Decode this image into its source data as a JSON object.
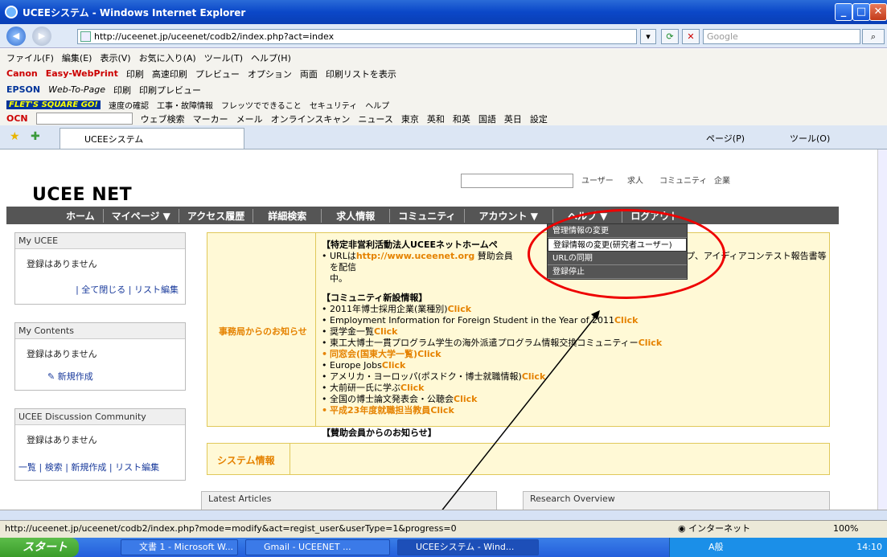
{
  "window": {
    "title": "UCEEシステム - Windows Internet Explorer",
    "min": "_",
    "max": "□",
    "close": "✕"
  },
  "address": {
    "url": "http://uceenet.jp/uceenet/codb2/index.php?act=index",
    "search_placeholder": "Google"
  },
  "menu": [
    "ファイル(F)",
    "編集(E)",
    "表示(V)",
    "お気に入り(A)",
    "ツール(T)",
    "ヘルプ(H)"
  ],
  "toolbar_canon": {
    "brand": "Canon",
    "product": "Easy-WebPrint",
    "items": [
      "印刷",
      "高速印刷",
      "プレビュー",
      "オプション",
      "両面",
      "印刷リストを表示"
    ]
  },
  "toolbar_epson": {
    "brand": "EPSON",
    "product": "Web-To-Page",
    "items": [
      "印刷",
      "印刷プレビュー"
    ]
  },
  "toolbar_flets": {
    "brand": "FLET'S SQUARE GO!",
    "items": [
      "速度の確認",
      "工事・故障情報",
      "フレッツでできること",
      "セキュリティ",
      "ヘルプ"
    ]
  },
  "toolbar_ocn": {
    "brand": "OCN",
    "items": [
      "ウェブ検索",
      "マーカー",
      "メール",
      "オンラインスキャン",
      "ニュース",
      "東京",
      "英和",
      "和英",
      "国語",
      "英日",
      "設定"
    ]
  },
  "tab": {
    "label": "UCEEシステム"
  },
  "tab_tools": [
    "ページ(P)",
    "ツール(O)"
  ],
  "site": {
    "logo": "UCEE NET",
    "search_tabs": [
      "ユーザー",
      "求人",
      "コミュニティ",
      "企業"
    ],
    "nav": [
      "ホーム",
      "マイページ ▼",
      "アクセス履歴",
      "詳細検索",
      "求人情報",
      "コミュニティ",
      "アカウント ▼",
      "ヘルプ ▼",
      "ログアウト"
    ],
    "dropdown": [
      "管理情報の変更",
      "登録情報の変更(研究者ユーザー)",
      "URLの同期",
      "登録停止"
    ]
  },
  "left": {
    "my_ucee": {
      "title": "My UCEE",
      "empty": "登録はありません",
      "links": "| 全て閉じる | リスト編集"
    },
    "my_contents": {
      "title": "My Contents",
      "empty": "登録はありません",
      "new": "新規作成"
    },
    "discussion": {
      "title": "UCEE Discussion Community",
      "empty": "登録はありません",
      "links": "一覧 | 検索 | 新規作成 | リスト編集"
    }
  },
  "notice": {
    "side_label": "事務局からのお知らせ",
    "heading1": "【特定非営利活動法人UCEEネットホームペ",
    "line1a": "URLは",
    "line1_link": "http://www.uceenet.org",
    "line1b": " 賛助会員",
    "line1c": "ンターンシップ、アイディアコンテスト報告書等を配信",
    "line1d": "中。",
    "heading2": "【コミュニティ新設情報】",
    "click": "Click",
    "items": [
      "2011年博士採用企業(業種別)",
      "Employment Information for Foreign Student in the Year of 2011",
      "奨学金一覧",
      "東工大博士一貫プログラム学生の海外派遣プログラム情報交換コミュニティー",
      "同窓会(国東大学一覧)",
      "Europe Jobs",
      "アメリカ・ヨーロッパ(ポスドク・博士就職情報)",
      "大前研一氏に学ぶ",
      "全国の博士論文発表会・公聴会",
      "平成23年度就職担当教員"
    ],
    "heading3": "【賛助会員からのお知らせ】"
  },
  "system_info": "システム情報",
  "bottom_boxes": [
    "Latest Articles",
    "Research Overview"
  ],
  "status": {
    "url": "http://uceenet.jp/uceenet/codb2/index.php?mode=modify&act=regist_user&userType=1&progress=0",
    "zone": "インターネット",
    "zoom": "100%"
  },
  "taskbar": {
    "start": "スタート",
    "tasks": [
      "文書 1 - Microsoft W...",
      "Gmail - UCEENET ...",
      "UCEEシステム - Wind..."
    ],
    "time": "14:10",
    "ime": "A般"
  }
}
